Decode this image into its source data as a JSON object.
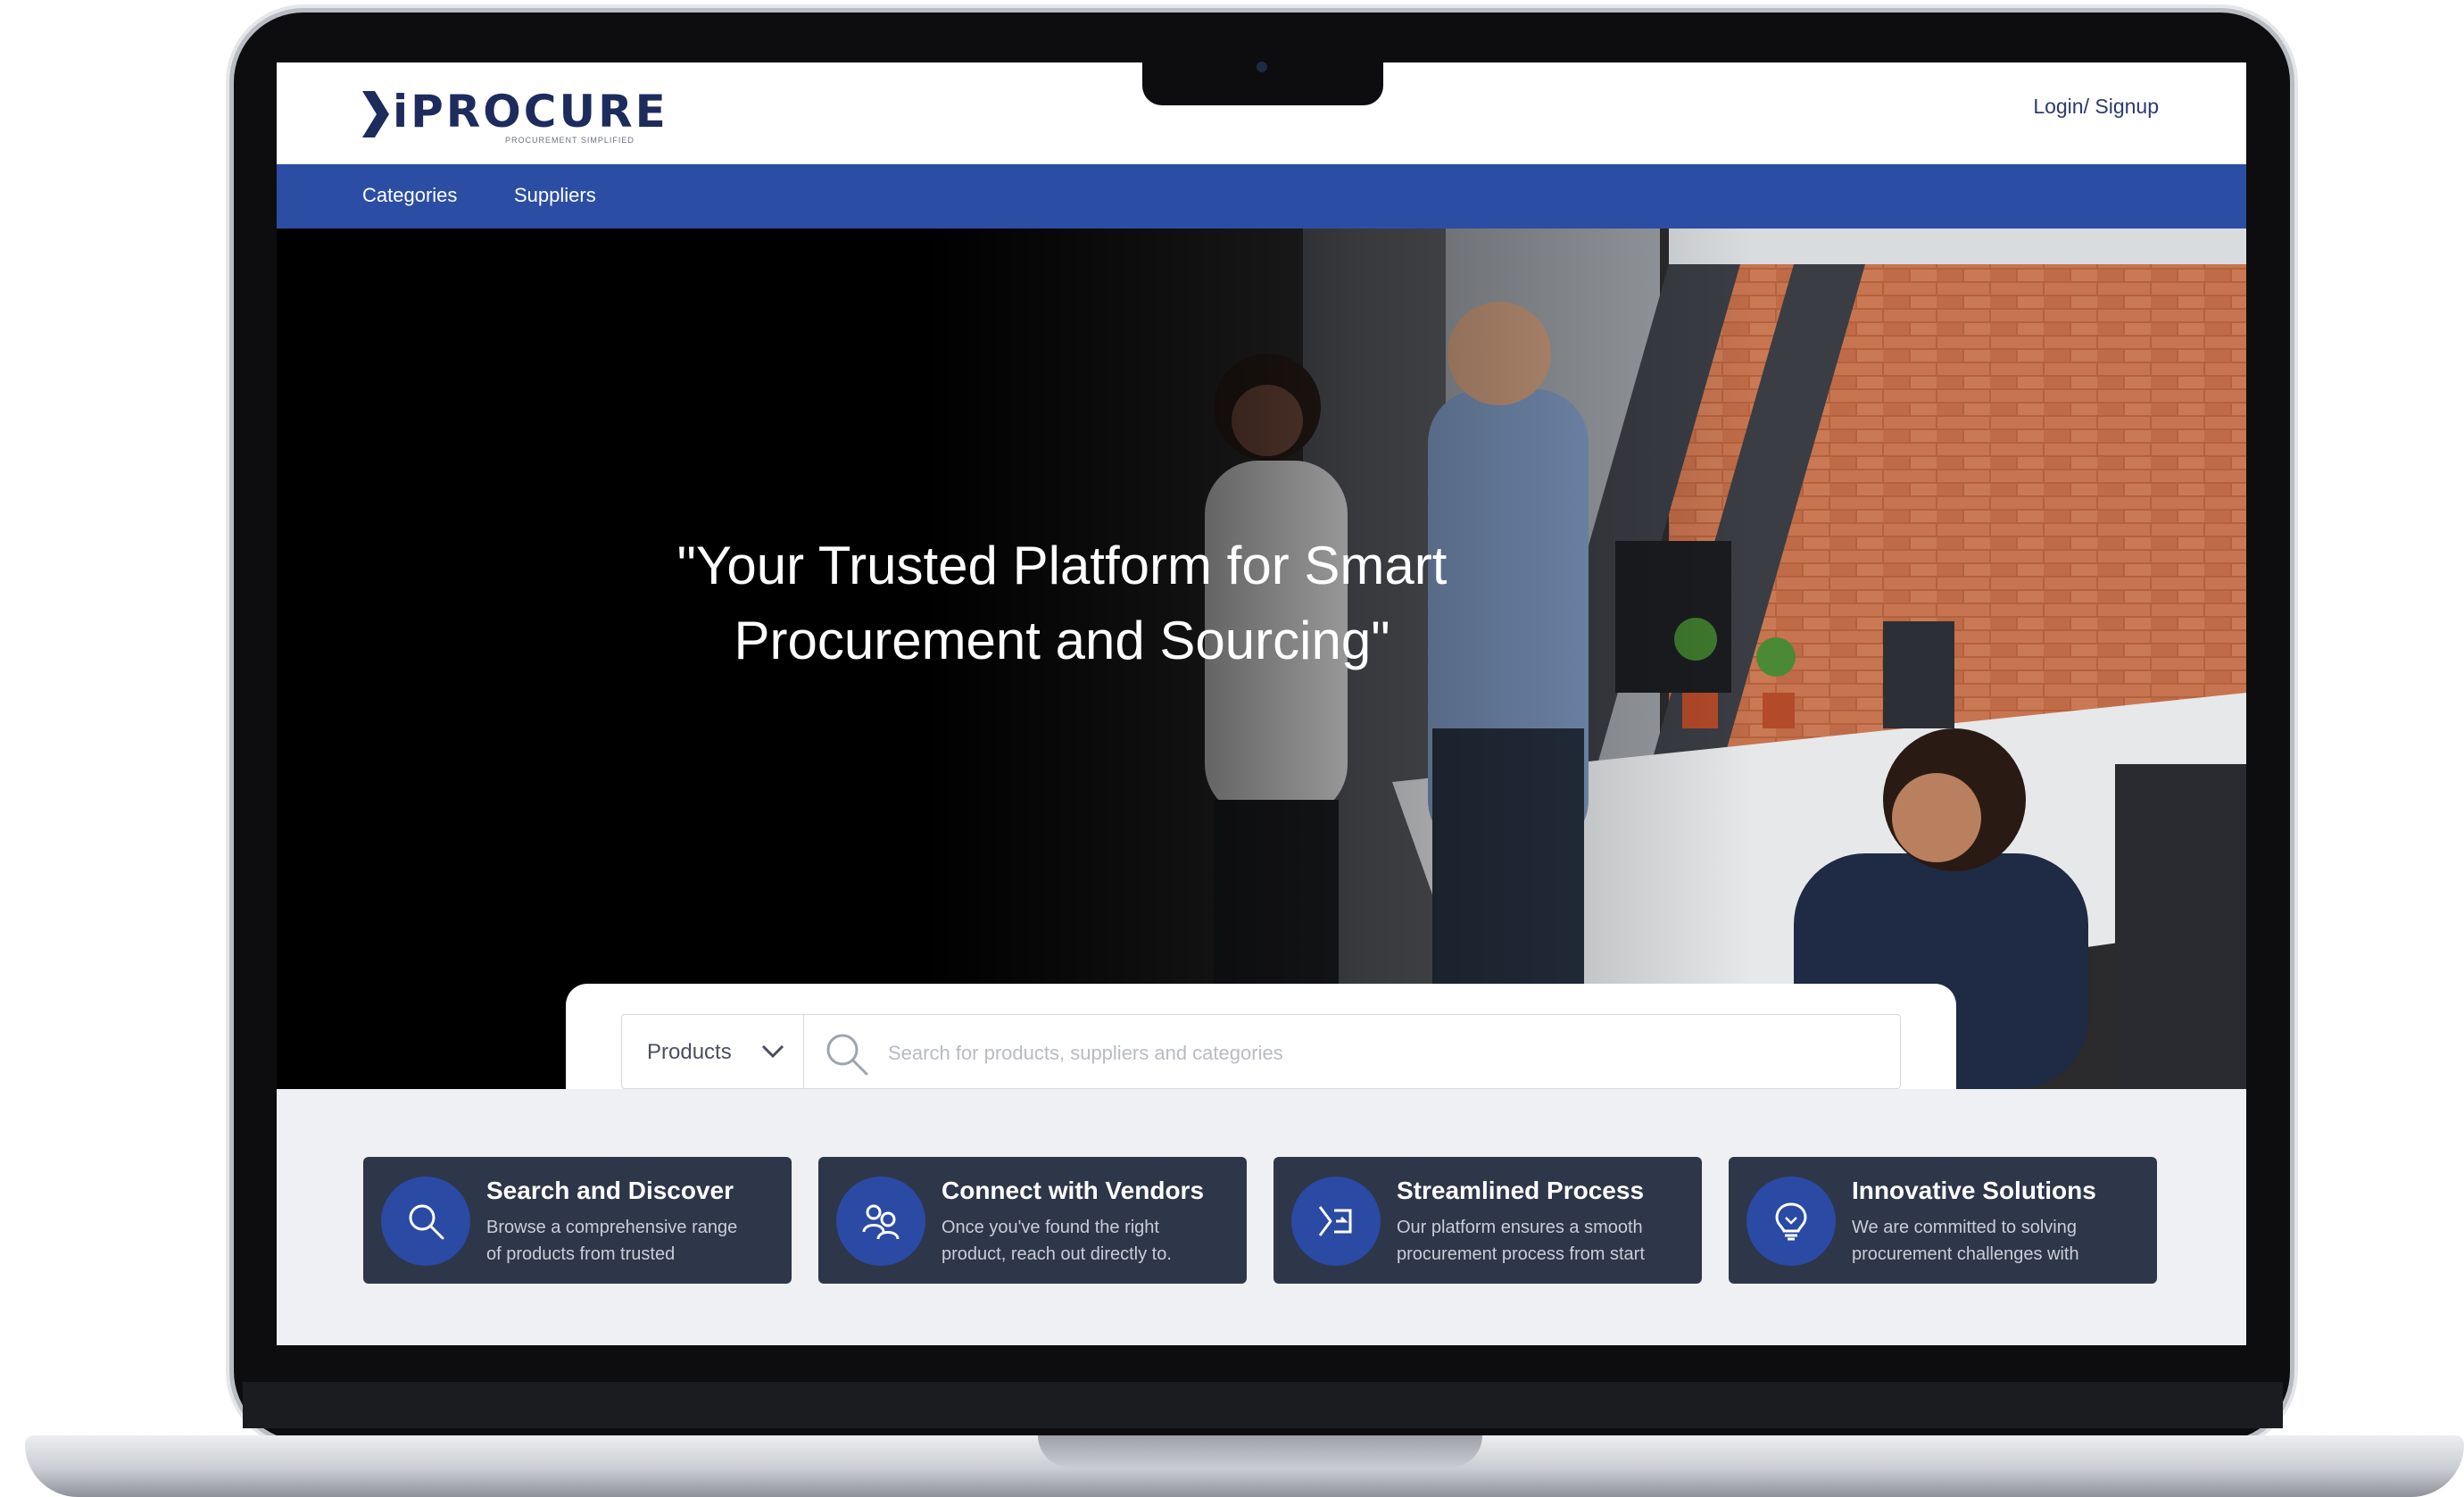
{
  "brand": {
    "name": "iPROCURE",
    "tagline": "PROCUREMENT SIMPLIFIED",
    "primary_color": "#2b4ea4",
    "dark_card_color": "#2e3649"
  },
  "header": {
    "login_label": "Login/ Signup"
  },
  "nav": {
    "items": [
      {
        "label": "Categories"
      },
      {
        "label": "Suppliers"
      }
    ]
  },
  "hero": {
    "title_line1": "\"Your Trusted Platform for Smart",
    "title_line2": "Procurement and Sourcing\""
  },
  "search": {
    "category_selected": "Products",
    "placeholder": "Search for products, suppliers and categories",
    "value": ""
  },
  "features": [
    {
      "icon": "search-icon",
      "title": "Search and Discover",
      "line1": "Browse a comprehensive range",
      "line2": "of products from trusted"
    },
    {
      "icon": "people-icon",
      "title": "Connect with Vendors",
      "line1": "Once you've found the right",
      "line2": "product, reach out directly to."
    },
    {
      "icon": "process-icon",
      "title": "Streamlined Process",
      "line1": "Our platform ensures a smooth",
      "line2": "procurement process from start"
    },
    {
      "icon": "lightbulb-icon",
      "title": "Innovative Solutions",
      "line1": "We are committed to solving",
      "line2": "procurement challenges with"
    }
  ]
}
